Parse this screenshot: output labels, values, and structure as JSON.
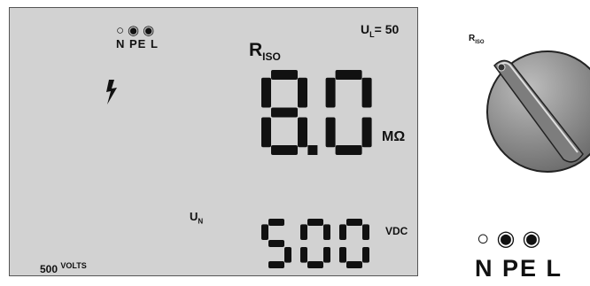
{
  "display": {
    "terminals": {
      "symbols": "○◉◉",
      "labels": "N PE L"
    },
    "ul": {
      "label": "U",
      "subscript": "L",
      "value": "= 50"
    },
    "function": {
      "label": "R",
      "subscript": "ISO"
    },
    "main_reading": {
      "value": "8.0",
      "unit": "MΩ"
    },
    "un": {
      "label": "U",
      "subscript": "N"
    },
    "test_voltage": {
      "value": "500",
      "unit": "VDC"
    },
    "volts": {
      "value": "500",
      "label": "VOLTS"
    },
    "hazard_icon": "lightning-icon"
  },
  "rotary_switch": {
    "label": "R",
    "subscript": "ISO"
  },
  "terminal_panel": {
    "symbols": "○◉◉",
    "labels": "N PE L"
  },
  "colors": {
    "lcd_background": "#d2d2d2",
    "segment": "#111111",
    "knob": "#8a8a8a"
  }
}
